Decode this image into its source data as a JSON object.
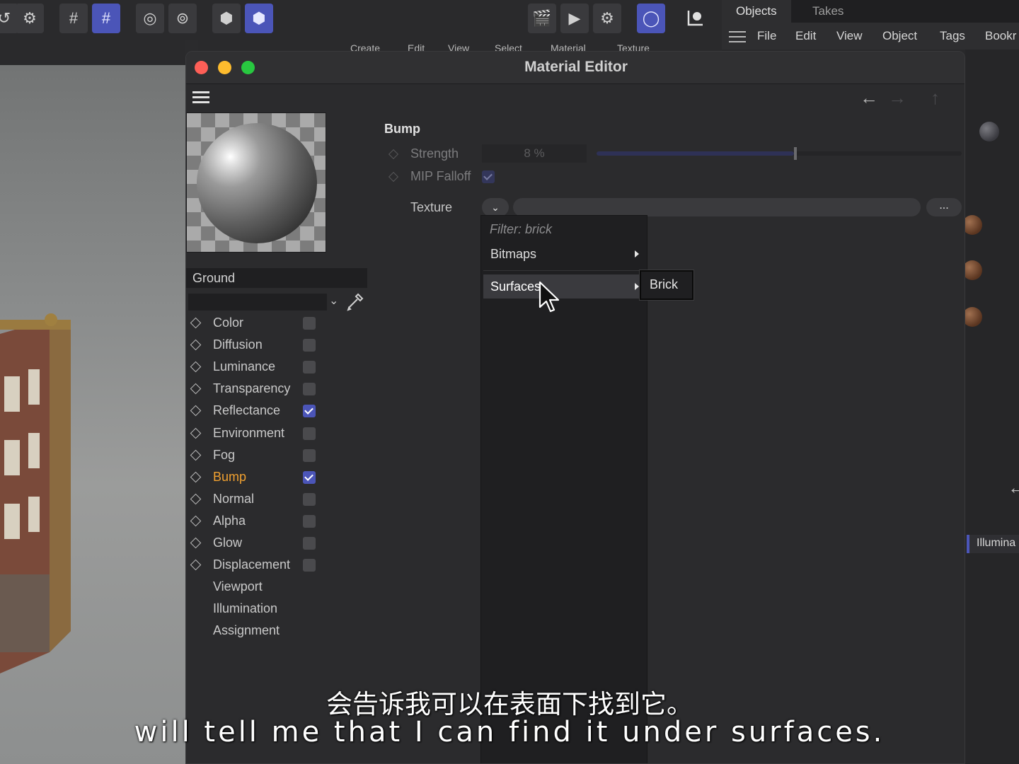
{
  "editor": {
    "title": "Material Editor"
  },
  "main_menu": [
    "Create",
    "Edit",
    "View",
    "Select",
    "Material",
    "Texture"
  ],
  "objects_panel": {
    "tabs": [
      "Objects",
      "Takes"
    ],
    "menu": [
      "File",
      "Edit",
      "View",
      "Object",
      "Tags",
      "Bookr"
    ],
    "illumination_label": "Illumina"
  },
  "material": {
    "name": "Ground",
    "channels": [
      {
        "label": "Color",
        "checked": false,
        "has_checkbox": true
      },
      {
        "label": "Diffusion",
        "checked": false,
        "has_checkbox": true
      },
      {
        "label": "Luminance",
        "checked": false,
        "has_checkbox": true
      },
      {
        "label": "Transparency",
        "checked": false,
        "has_checkbox": true
      },
      {
        "label": "Reflectance",
        "checked": true,
        "has_checkbox": true
      },
      {
        "label": "Environment",
        "checked": false,
        "has_checkbox": true
      },
      {
        "label": "Fog",
        "checked": false,
        "has_checkbox": true
      },
      {
        "label": "Bump",
        "checked": true,
        "has_checkbox": true,
        "active": true
      },
      {
        "label": "Normal",
        "checked": false,
        "has_checkbox": true
      },
      {
        "label": "Alpha",
        "checked": false,
        "has_checkbox": true
      },
      {
        "label": "Glow",
        "checked": false,
        "has_checkbox": true
      },
      {
        "label": "Displacement",
        "checked": false,
        "has_checkbox": true
      },
      {
        "label": "Viewport",
        "has_checkbox": false
      },
      {
        "label": "Illumination",
        "has_checkbox": false
      },
      {
        "label": "Assignment",
        "has_checkbox": false
      }
    ]
  },
  "bump": {
    "section_title": "Bump",
    "strength_label": "Strength",
    "strength_value": "8 %",
    "strength_fraction": 0.54,
    "mip_label": "MIP Falloff",
    "mip_checked": true,
    "texture_label": "Texture",
    "more_label": "..."
  },
  "dropdown": {
    "filter": "Filter: brick",
    "items": [
      "Bitmaps",
      "Surfaces"
    ],
    "highlighted": "Surfaces",
    "submenu_item": "Brick"
  },
  "subtitles": {
    "zh": "会告诉我可以在表面下找到它。",
    "en": "will tell me that I can find it under surfaces."
  },
  "colors": {
    "accent": "#4b55b8",
    "active_channel": "#f0a030",
    "close": "#fe5f57",
    "minimize": "#febc2e",
    "maximize": "#28c840"
  }
}
